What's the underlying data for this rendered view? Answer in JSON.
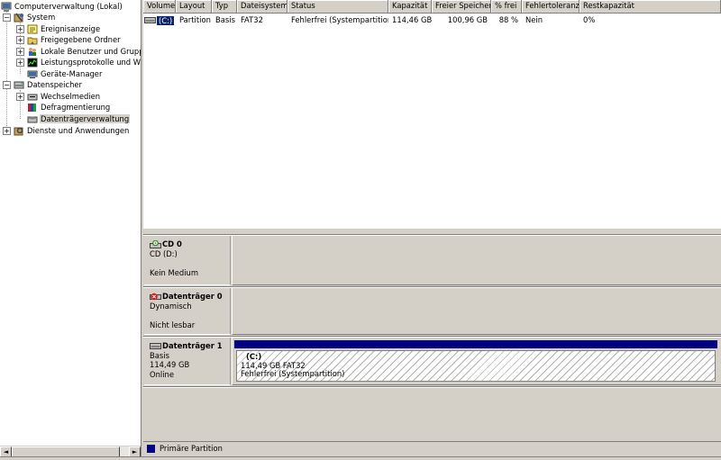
{
  "tree": {
    "items": [
      {
        "label": "Computerverwaltung (Lokal)",
        "icon": "computer-icon",
        "expander": ""
      },
      {
        "label": "System",
        "icon": "tools-icon",
        "expander": "−"
      },
      {
        "label": "Ereignisanzeige",
        "icon": "event-viewer-icon",
        "expander": "+"
      },
      {
        "label": "Freigegebene Ordner",
        "icon": "shared-folder-icon",
        "expander": "+"
      },
      {
        "label": "Lokale Benutzer und Gruppen",
        "icon": "users-icon",
        "expander": "+"
      },
      {
        "label": "Leistungsprotokolle und Warnungen",
        "icon": "performance-icon",
        "expander": "+"
      },
      {
        "label": "Geräte-Manager",
        "icon": "device-manager-icon",
        "expander": ""
      },
      {
        "label": "Datenspeicher",
        "icon": "storage-icon",
        "expander": "−"
      },
      {
        "label": "Wechselmedien",
        "icon": "removable-media-icon",
        "expander": "+"
      },
      {
        "label": "Defragmentierung",
        "icon": "defrag-icon",
        "expander": ""
      },
      {
        "label": "Datenträgerverwaltung",
        "icon": "disk-management-icon",
        "expander": ""
      },
      {
        "label": "Dienste und Anwendungen",
        "icon": "services-icon",
        "expander": "+"
      }
    ],
    "scroll_left": "◄",
    "scroll_right": "►"
  },
  "volumes": {
    "columns": [
      "Volume",
      "Layout",
      "Typ",
      "Dateisystem",
      "Status",
      "Kapazität",
      "Freier Speicher",
      "% frei",
      "Fehlertoleranz",
      "Restkapazität"
    ],
    "rows": [
      {
        "volume": "(C:)",
        "layout": "Partition",
        "typ": "Basis",
        "dateisystem": "FAT32",
        "status": "Fehlerfrei (Systempartition)",
        "kapazitaet": "114,46 GB",
        "frei": "100,96 GB",
        "prozent": "88 %",
        "fehlertoleranz": "Nein",
        "rest": "0%"
      }
    ]
  },
  "disks": [
    {
      "name": "CD 0",
      "icon": "cd-drive-icon",
      "lines": [
        "CD (D:)",
        "",
        "Kein Medium"
      ]
    },
    {
      "name": "Datenträger 0",
      "icon": "disk-error-icon",
      "lines": [
        "Dynamisch",
        "",
        "Nicht lesbar"
      ]
    },
    {
      "name": "Datenträger 1",
      "icon": "disk-icon",
      "lines": [
        "Basis",
        "114,49 GB",
        "Online"
      ],
      "partition": {
        "name": "(C:)",
        "size": "114,49 GB FAT32",
        "status": "Fehlerfrei (Systempartition)"
      }
    }
  ],
  "legend": {
    "label": "Primäre Partition",
    "color": "#000080"
  }
}
